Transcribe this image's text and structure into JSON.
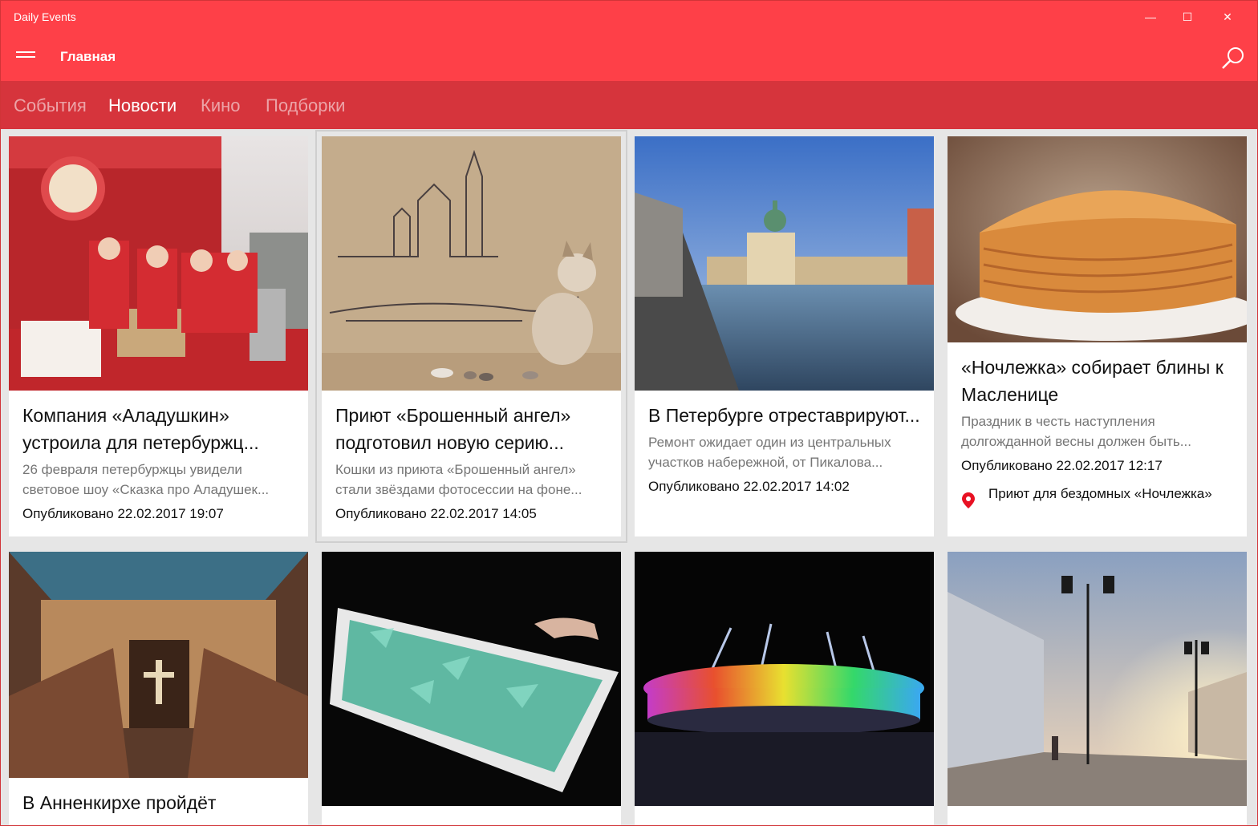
{
  "window": {
    "title": "Daily Events",
    "minimize_glyph": "—",
    "maximize_glyph": "☐",
    "close_glyph": "✕"
  },
  "appbar": {
    "page_title": "Главная",
    "menu_icon": "hamburger-icon",
    "search_icon": "search-icon"
  },
  "pivot": {
    "tabs": [
      {
        "label": "События",
        "active": false
      },
      {
        "label": "Новости",
        "active": true
      },
      {
        "label": "Кино",
        "active": false
      },
      {
        "label": "Подборки",
        "active": false
      }
    ]
  },
  "cards": [
    {
      "title": "Компания «Аладушкин» устроила для петербуржц...",
      "description": "26 февраля петербуржцы увидели световое шоу «Сказка про Аладушек...",
      "date": "Опубликовано 22.02.2017 19:07"
    },
    {
      "title": "Приют «Брошенный ангел» подготовил новую серию...",
      "description": "Кошки из приюта «Брошенный ангел» стали звёздами фотосессии на фоне...",
      "date": "Опубликовано 22.02.2017 14:05"
    },
    {
      "title": "В Петербурге отреставрируют...",
      "description": "Ремонт ожидает один из центральных участков набережной, от Пикалова...",
      "date": "Опубликовано 22.02.2017 14:02"
    },
    {
      "title": "«Ночлежка» собирает блины к Масленице",
      "description": "Праздник в честь наступления долгожданной весны должен быть...",
      "date": "Опубликовано 22.02.2017 12:17",
      "place": "Приют для бездомных «Ночлежка»"
    },
    {
      "title": "В Анненкирхе пройдёт"
    },
    {
      "title": ""
    },
    {
      "title": ""
    },
    {
      "title": ""
    }
  ],
  "colors": {
    "accent": "#fe4048",
    "pivot_background": "#d6343c",
    "pin": "#e81123"
  }
}
